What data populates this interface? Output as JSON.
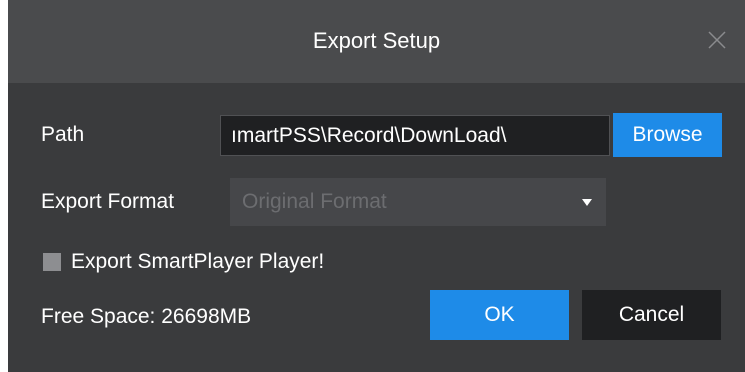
{
  "dialog": {
    "title": "Export Setup",
    "close_icon": "close-icon"
  },
  "path": {
    "label": "Path",
    "value": "ımartPSS\\Record\\DownLoad\\",
    "browse_label": "Browse"
  },
  "export_format": {
    "label": "Export Format",
    "selected": "Original Format",
    "disabled": true,
    "chevron_icon": "chevron-down-icon"
  },
  "export_player": {
    "label": "Export SmartPlayer Player!",
    "checked": false
  },
  "free_space": {
    "label": "Free Space:",
    "value": "26698MB"
  },
  "buttons": {
    "ok_label": "OK",
    "cancel_label": "Cancel"
  },
  "colors": {
    "background": "#3a3b3d",
    "title_bar": "#4a4b4d",
    "accent": "#1e8be8",
    "field": "#1f2022",
    "disabled_select": "#46474a",
    "disabled_text": "#6c6d70"
  }
}
